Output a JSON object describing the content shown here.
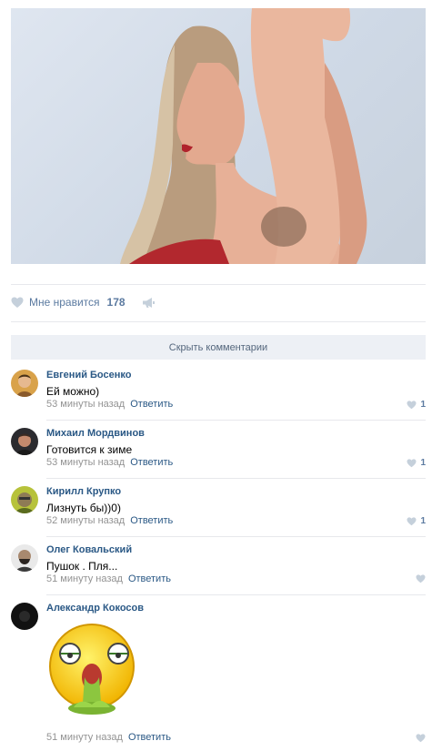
{
  "post": {
    "likes_label": "Мне нравится",
    "likes_count": "178"
  },
  "hide_comments_label": "Скрыть комментарии",
  "reply_label": "Ответить",
  "comments": [
    {
      "author": "Евгений Босенко",
      "text": "Ей можно)",
      "time": "53 минуты назад",
      "likes": "1"
    },
    {
      "author": "Михаил Мордвинов",
      "text": "Готовится к зиме",
      "time": "53 минуты назад",
      "likes": "1"
    },
    {
      "author": "Кирилл Крупко",
      "text": "Лизнуть бы))0)",
      "time": "52 минуты назад",
      "likes": "1"
    },
    {
      "author": "Олег Ковальский",
      "text": "Пушок . Пля...",
      "time": "51 минуту назад",
      "likes": ""
    },
    {
      "author": "Александр Кокосов",
      "text": "",
      "time": "51 минуту назад",
      "likes": ""
    }
  ],
  "icons": {
    "like": "heart-icon",
    "share": "megaphone-icon"
  },
  "colors": {
    "link": "#2a5885",
    "meta": "#939393",
    "accent": "#5b7aa0"
  }
}
